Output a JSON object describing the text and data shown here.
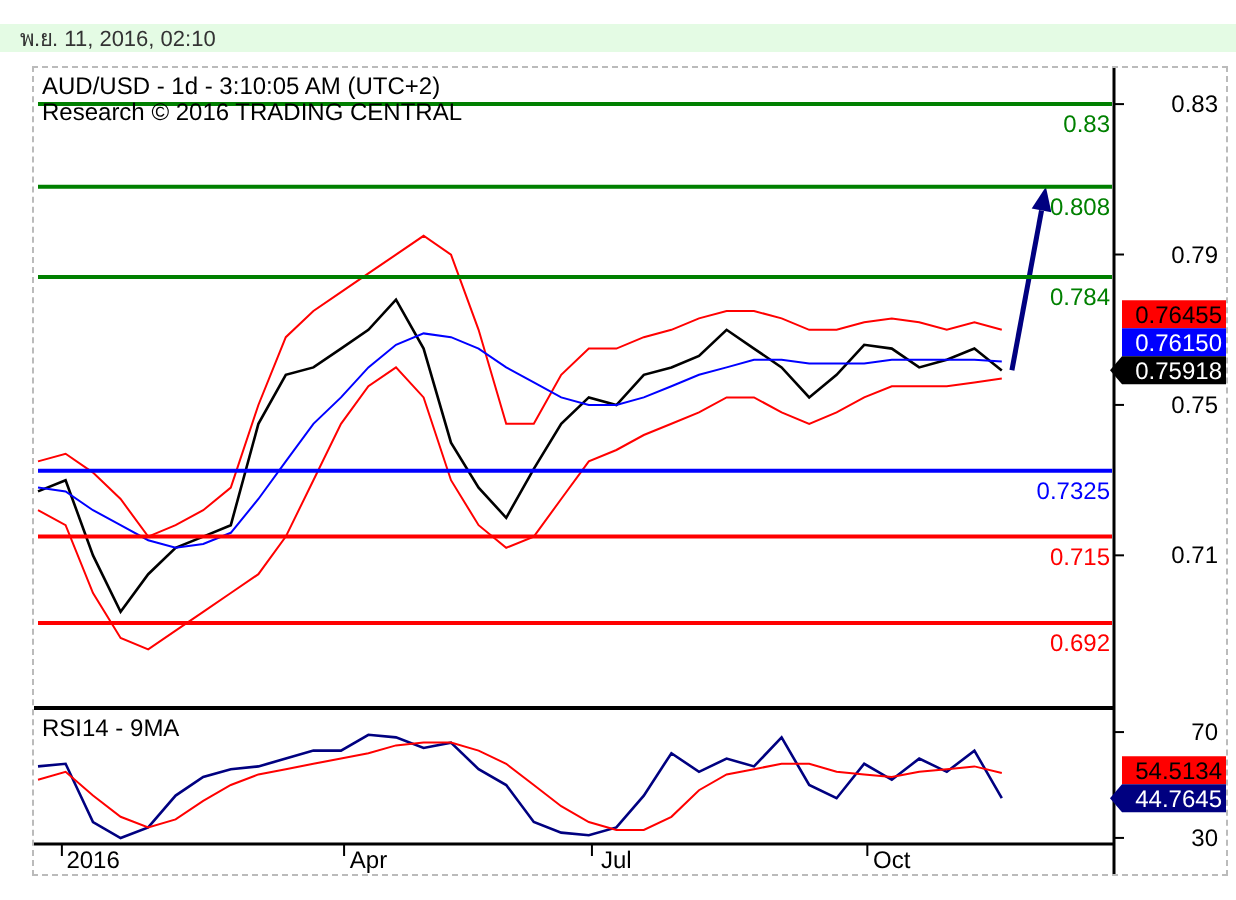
{
  "date_bar": {
    "text": "พ.ย. 11, 2016, 02:10"
  },
  "price_chart": {
    "title_lines": [
      "AUD/USD - 1d - 3:10:05 AM (UTC+2)",
      "Research © 2016 TRADING CENTRAL"
    ],
    "chart_data": {
      "type": "line",
      "ylim": [
        0.6694,
        0.8396
      ],
      "yticks": [
        0.71,
        0.75,
        0.79,
        0.83
      ],
      "series": [
        {
          "color": "#000000",
          "values": [
            0.727,
            0.73,
            0.71,
            0.695,
            0.705,
            0.712,
            0.715,
            0.718,
            0.745,
            0.758,
            0.76,
            0.765,
            0.77,
            0.778,
            0.765,
            0.74,
            0.728,
            0.72,
            0.733,
            0.745,
            0.752,
            0.75,
            0.758,
            0.76,
            0.763,
            0.77,
            0.765,
            0.76,
            0.752,
            0.758,
            0.766,
            0.765,
            0.76,
            0.762,
            0.765,
            0.7592,
            null,
            null,
            null,
            null
          ]
        },
        {
          "color": "#ff0000",
          "values": [
            0.735,
            0.737,
            0.732,
            0.725,
            0.715,
            0.718,
            0.722,
            0.728,
            0.75,
            0.768,
            0.775,
            0.78,
            0.785,
            0.79,
            0.795,
            0.79,
            0.77,
            0.745,
            0.745,
            0.758,
            0.765,
            0.765,
            0.768,
            0.77,
            0.773,
            0.775,
            0.775,
            0.773,
            0.77,
            0.77,
            0.772,
            0.773,
            0.772,
            0.77,
            0.772,
            0.77,
            null,
            null,
            null,
            null
          ]
        },
        {
          "color": "#ff0000",
          "values": [
            0.722,
            0.718,
            0.7,
            0.688,
            0.685,
            0.69,
            0.695,
            0.7,
            0.705,
            0.715,
            0.73,
            0.745,
            0.755,
            0.76,
            0.752,
            0.73,
            0.718,
            0.712,
            0.715,
            0.725,
            0.735,
            0.738,
            0.742,
            0.745,
            0.748,
            0.752,
            0.752,
            0.748,
            0.745,
            0.748,
            0.752,
            0.755,
            0.755,
            0.755,
            0.756,
            0.757,
            null,
            null,
            null,
            null
          ]
        },
        {
          "color": "#0000ff",
          "values": [
            0.728,
            0.727,
            0.722,
            0.718,
            0.714,
            0.712,
            0.713,
            0.716,
            0.725,
            0.735,
            0.745,
            0.752,
            0.76,
            0.766,
            0.769,
            0.768,
            0.765,
            0.76,
            0.756,
            0.752,
            0.75,
            0.75,
            0.752,
            0.755,
            0.758,
            0.76,
            0.762,
            0.762,
            0.761,
            0.761,
            0.761,
            0.762,
            0.762,
            0.762,
            0.762,
            0.7615,
            null,
            null,
            null,
            null
          ]
        },
        {
          "name": "0.83",
          "color": "#008000",
          "values": [
            0.83,
            0.83,
            0.83,
            0.83,
            0.83,
            0.83,
            0.83,
            0.83,
            0.83,
            0.83,
            0.83,
            0.83,
            0.83,
            0.83,
            0.83,
            0.83,
            0.83,
            0.83,
            0.83,
            0.83,
            0.83,
            0.83,
            0.83,
            0.83,
            0.83,
            0.83,
            0.83,
            0.83,
            0.83,
            0.83,
            0.83,
            0.83,
            0.83,
            0.83,
            0.83,
            0.83,
            0.83,
            0.83,
            0.83,
            0.83
          ]
        },
        {
          "name": "0.808",
          "color": "#008000",
          "values": [
            0.808,
            0.808,
            0.808,
            0.808,
            0.808,
            0.808,
            0.808,
            0.808,
            0.808,
            0.808,
            0.808,
            0.808,
            0.808,
            0.808,
            0.808,
            0.808,
            0.808,
            0.808,
            0.808,
            0.808,
            0.808,
            0.808,
            0.808,
            0.808,
            0.808,
            0.808,
            0.808,
            0.808,
            0.808,
            0.808,
            0.808,
            0.808,
            0.808,
            0.808,
            0.808,
            0.808,
            0.808,
            0.808,
            0.808,
            0.808
          ]
        },
        {
          "name": "0.784",
          "color": "#008000",
          "values": [
            0.784,
            0.784,
            0.784,
            0.784,
            0.784,
            0.784,
            0.784,
            0.784,
            0.784,
            0.784,
            0.784,
            0.784,
            0.784,
            0.784,
            0.784,
            0.784,
            0.784,
            0.784,
            0.784,
            0.784,
            0.784,
            0.784,
            0.784,
            0.784,
            0.784,
            0.784,
            0.784,
            0.784,
            0.784,
            0.784,
            0.784,
            0.784,
            0.784,
            0.784,
            0.784,
            0.784,
            0.784,
            0.784,
            0.784,
            0.784
          ]
        },
        {
          "name": "0.7325",
          "color": "#0000ff",
          "values": [
            0.7325,
            0.7325,
            0.7325,
            0.7325,
            0.7325,
            0.7325,
            0.7325,
            0.7325,
            0.7325,
            0.7325,
            0.7325,
            0.7325,
            0.7325,
            0.7325,
            0.7325,
            0.7325,
            0.7325,
            0.7325,
            0.7325,
            0.7325,
            0.7325,
            0.7325,
            0.7325,
            0.7325,
            0.7325,
            0.7325,
            0.7325,
            0.7325,
            0.7325,
            0.7325,
            0.7325,
            0.7325,
            0.7325,
            0.7325,
            0.7325,
            0.7325,
            0.7325,
            0.7325,
            0.7325,
            0.7325
          ]
        },
        {
          "name": "0.715",
          "color": "#ff0000",
          "values": [
            0.715,
            0.715,
            0.715,
            0.715,
            0.715,
            0.715,
            0.715,
            0.715,
            0.715,
            0.715,
            0.715,
            0.715,
            0.715,
            0.715,
            0.715,
            0.715,
            0.715,
            0.715,
            0.715,
            0.715,
            0.715,
            0.715,
            0.715,
            0.715,
            0.715,
            0.715,
            0.715,
            0.715,
            0.715,
            0.715,
            0.715,
            0.715,
            0.715,
            0.715,
            0.715,
            0.715,
            0.715,
            0.715,
            0.715,
            0.715
          ]
        },
        {
          "name": "0.692",
          "color": "#ff0000",
          "values": [
            0.692,
            0.692,
            0.692,
            0.692,
            0.692,
            0.692,
            0.692,
            0.692,
            0.692,
            0.692,
            0.692,
            0.692,
            0.692,
            0.692,
            0.692,
            0.692,
            0.692,
            0.692,
            0.692,
            0.692,
            0.692,
            0.692,
            0.692,
            0.692,
            0.692,
            0.692,
            0.692,
            0.692,
            0.692,
            0.692,
            0.692,
            0.692,
            0.692,
            0.692,
            0.692,
            0.692,
            0.692,
            0.692,
            0.692,
            0.692
          ]
        }
      ]
    },
    "price_tags": [
      {
        "text": "0.76455",
        "color": "#ff0000",
        "kind": "box"
      },
      {
        "text": "0.76150",
        "color": "#0000ff",
        "kind": "box"
      },
      {
        "text": "0.75918",
        "color": "#000000",
        "kind": "pointer"
      }
    ]
  },
  "rsi_chart": {
    "title_joiner": "-",
    "chart_data": {
      "type": "line",
      "ylim": [
        27.7,
        79.1
      ],
      "yticks": [
        30,
        70
      ],
      "categories": [
        null,
        null,
        "2016",
        null,
        null,
        null,
        null,
        null,
        null,
        null,
        null,
        null,
        "Apr",
        null,
        null,
        null,
        null,
        null,
        null,
        null,
        null,
        "Jul",
        null,
        null,
        null,
        null,
        null,
        null,
        null,
        null,
        null,
        "Oct",
        null,
        null,
        null,
        null
      ],
      "series": [
        {
          "name": "RSI14",
          "color": "#000080",
          "values": [
            57,
            58,
            36,
            30,
            34,
            46,
            53,
            56,
            57,
            60,
            63,
            63,
            69,
            68,
            64,
            66,
            56,
            50,
            36,
            32,
            31,
            34,
            46,
            62,
            55,
            60,
            57,
            68,
            50,
            45,
            58,
            52,
            60,
            55,
            63,
            45
          ]
        },
        {
          "name": "9MA",
          "color": "#ff0000",
          "values": [
            52,
            55,
            46,
            38,
            34,
            37,
            44,
            50,
            54,
            56,
            58,
            60,
            62,
            65,
            66,
            66,
            63,
            58,
            50,
            42,
            36,
            33,
            33,
            38,
            48,
            54,
            56,
            58,
            58,
            55,
            54,
            53,
            55,
            56,
            57,
            54.5
          ]
        }
      ]
    },
    "value_tags": [
      {
        "text": "54.5134",
        "color": "#ff0000",
        "kind": "box"
      },
      {
        "text": "44.7645",
        "color": "#000080",
        "kind": "pointer"
      }
    ]
  }
}
